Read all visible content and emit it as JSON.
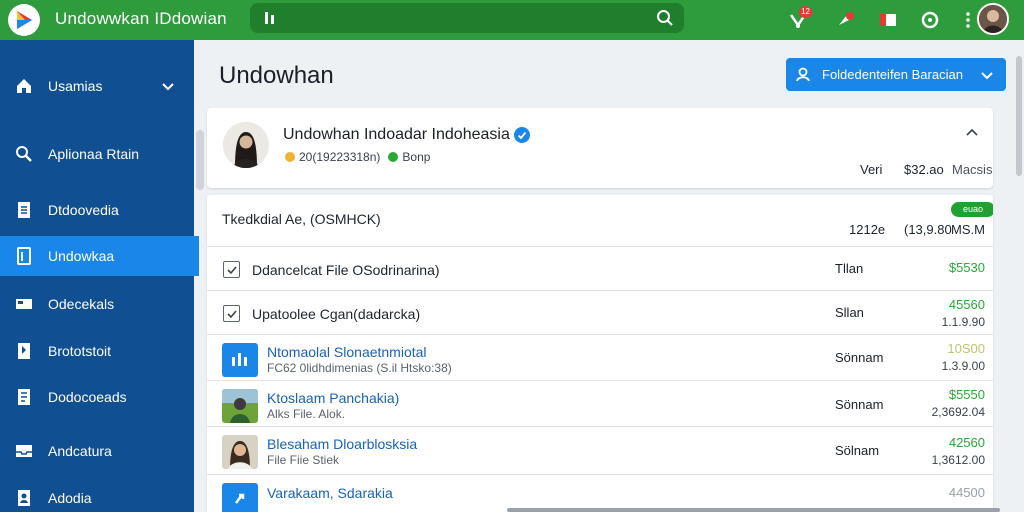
{
  "app": {
    "title": "Undowwkan IDdowian",
    "brand_color": "#2e9b3c",
    "sidebar_color": "#0f4f92",
    "accent_color": "#1a86e8"
  },
  "topbar": {
    "search_placeholder": "",
    "notification_badge": "12"
  },
  "sidebar": {
    "items": [
      {
        "label": "Usamias",
        "icon": "home-icon"
      },
      {
        "label": "Aplionaa Rtain",
        "icon": "search-icon"
      },
      {
        "label": "Dtdoovedia",
        "icon": "document-icon"
      },
      {
        "label": "Undowkaa",
        "icon": "tablet-icon"
      },
      {
        "label": "Odecekals",
        "icon": "card-icon"
      },
      {
        "label": "Brototstoit",
        "icon": "bookmark-icon"
      },
      {
        "label": "Dodocoeads",
        "icon": "book-icon"
      },
      {
        "label": "Andcatura",
        "icon": "inbox-icon"
      },
      {
        "label": "Adodia",
        "icon": "user-icon"
      }
    ]
  },
  "main": {
    "title": "Undowhan",
    "action_button": "Foldedenteifen Baracian"
  },
  "profile": {
    "name": "Undowhan Indoadar Indoheasia",
    "meta_date": "20(19223318n)",
    "meta_status": "Bonp",
    "right_label": "Veri",
    "right_price": "$32.ao",
    "right_unit": "Macsis"
  },
  "list": {
    "header_title": "Tkedkdial   Ae, (OSMHCK)",
    "pill": "euao",
    "col1": "1212e",
    "col2": "(13,9.80",
    "col3": "MS.M",
    "rows": [
      {
        "type": "check",
        "title": "Ddancelcat File OSodrinarina)",
        "count": "Tllan",
        "amount": "$5530",
        "sub": ""
      },
      {
        "type": "check",
        "title": "Upatoolee Cgan(dadarcka)",
        "count": "Sllan",
        "amount": "45560",
        "sub": "1.1.9.90"
      },
      {
        "type": "file",
        "title": "Ntomaolal Slonaetnmiotal",
        "subtitle": "FC62 0lidhdimenias (S.il Htsko:38)",
        "count": "Sönnam",
        "amount": "10S00",
        "sub": "1.3.9.00"
      },
      {
        "type": "photo",
        "title": "Ktoslaam Panchakia)",
        "subtitle": "Alks File. Alok.",
        "count": "Sönnam",
        "amount": "$5550",
        "sub": "2,3692.04"
      },
      {
        "type": "portrait",
        "title": "Blesaham Dloarblosksia",
        "subtitle": "File Fiie Stiek",
        "count": "Sölnam",
        "amount": "42560",
        "sub": "1,3612.00"
      },
      {
        "type": "file",
        "title": "Varakaam, Sdarakia",
        "subtitle": "",
        "count": "",
        "amount": "44500",
        "sub": ""
      }
    ]
  }
}
